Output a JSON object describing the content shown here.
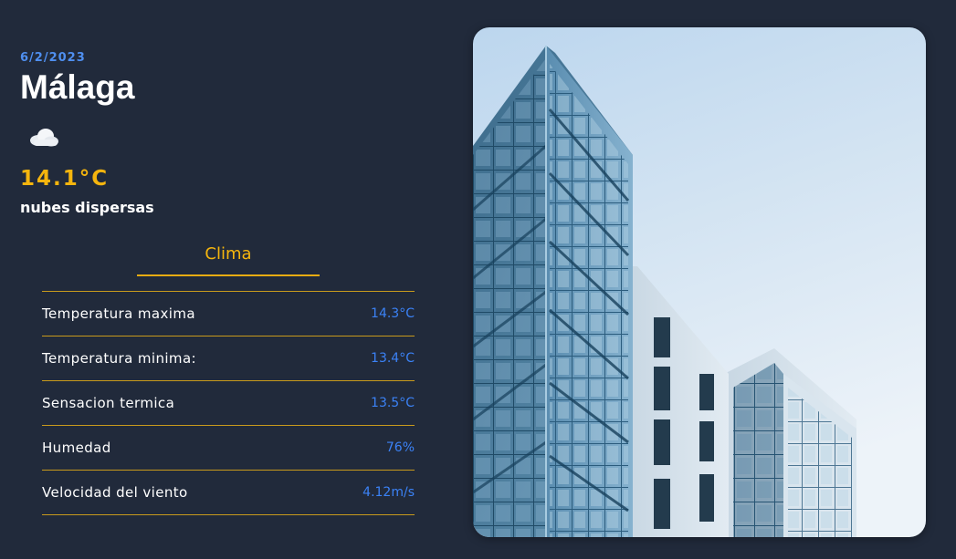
{
  "weather": {
    "date": "6/2/2023",
    "city": "Málaga",
    "icon": "cloud-icon",
    "temperature": "14.1°C",
    "description": "nubes dispersas"
  },
  "tabs": [
    {
      "label": "Clima",
      "active": true
    }
  ],
  "details": [
    {
      "label": "Temperatura maxima",
      "value": "14.3°C"
    },
    {
      "label": "Temperatura minima:",
      "value": "13.4°C"
    },
    {
      "label": "Sensacion termica",
      "value": "13.5°C"
    },
    {
      "label": "Humedad",
      "value": "76%"
    },
    {
      "label": "Velocidad del viento",
      "value": "4.12m/s"
    }
  ],
  "colors": {
    "background": "#212a3b",
    "accent": "#f5b50e",
    "value_blue": "#3b82f6",
    "date_blue": "#4f8ff0",
    "divider": "#c89a1c"
  },
  "image": {
    "subject": "building-photo"
  }
}
